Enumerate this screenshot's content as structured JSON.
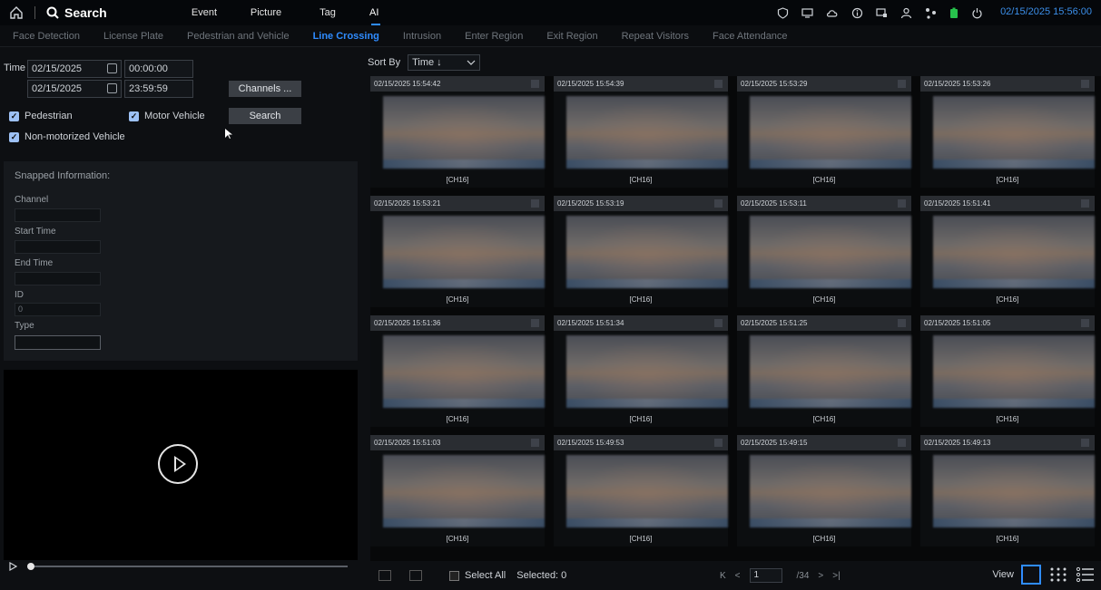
{
  "topbar": {
    "title": "Search",
    "tabs": [
      {
        "label": "Event"
      },
      {
        "label": "Picture"
      },
      {
        "label": "Tag"
      },
      {
        "label": "AI"
      }
    ],
    "datetime": "02/15/2025 15:56:00"
  },
  "subtabs": [
    {
      "label": "Face Detection"
    },
    {
      "label": "License Plate"
    },
    {
      "label": "Pedestrian and Vehicle"
    },
    {
      "label": "Line Crossing"
    },
    {
      "label": "Intrusion"
    },
    {
      "label": "Enter Region"
    },
    {
      "label": "Exit Region"
    },
    {
      "label": "Repeat Visitors"
    },
    {
      "label": "Face Attendance"
    }
  ],
  "filters": {
    "time_label": "Time",
    "start_date": "02/15/2025",
    "start_time": "00:00:00",
    "end_date": "02/15/2025",
    "end_time": "23:59:59",
    "channels_button": "Channels ...",
    "search_button": "Search",
    "pedestrian": "Pedestrian",
    "motor_vehicle": "Motor Vehicle",
    "non_motorized": "Non-motorized Vehicle"
  },
  "snapped": {
    "title": "Snapped Information:",
    "channel_label": "Channel",
    "start_label": "Start Time",
    "end_label": "End Time",
    "id_label": "ID",
    "id_value": "0",
    "type_label": "Type"
  },
  "sort": {
    "label": "Sort By",
    "value": "Time ↓"
  },
  "cards": [
    {
      "time": "02/15/2025 15:54:42",
      "ch": "[CH16]"
    },
    {
      "time": "02/15/2025 15:54:39",
      "ch": "[CH16]"
    },
    {
      "time": "02/15/2025 15:53:29",
      "ch": "[CH16]"
    },
    {
      "time": "02/15/2025 15:53:26",
      "ch": "[CH16]"
    },
    {
      "time": "02/15/2025 15:53:21",
      "ch": "[CH16]"
    },
    {
      "time": "02/15/2025 15:53:19",
      "ch": "[CH16]"
    },
    {
      "time": "02/15/2025 15:53:11",
      "ch": "[CH16]"
    },
    {
      "time": "02/15/2025 15:51:41",
      "ch": "[CH16]"
    },
    {
      "time": "02/15/2025 15:51:36",
      "ch": "[CH16]"
    },
    {
      "time": "02/15/2025 15:51:34",
      "ch": "[CH16]"
    },
    {
      "time": "02/15/2025 15:51:25",
      "ch": "[CH16]"
    },
    {
      "time": "02/15/2025 15:51:05",
      "ch": "[CH16]"
    },
    {
      "time": "02/15/2025 15:51:03",
      "ch": "[CH16]"
    },
    {
      "time": "02/15/2025 15:49:53",
      "ch": "[CH16]"
    },
    {
      "time": "02/15/2025 15:49:15",
      "ch": "[CH16]"
    },
    {
      "time": "02/15/2025 15:49:13",
      "ch": "[CH16]"
    }
  ],
  "bottom": {
    "select_all": "Select All",
    "selected": "Selected: 0",
    "page": "1",
    "total": "/34",
    "view_label": "View"
  }
}
